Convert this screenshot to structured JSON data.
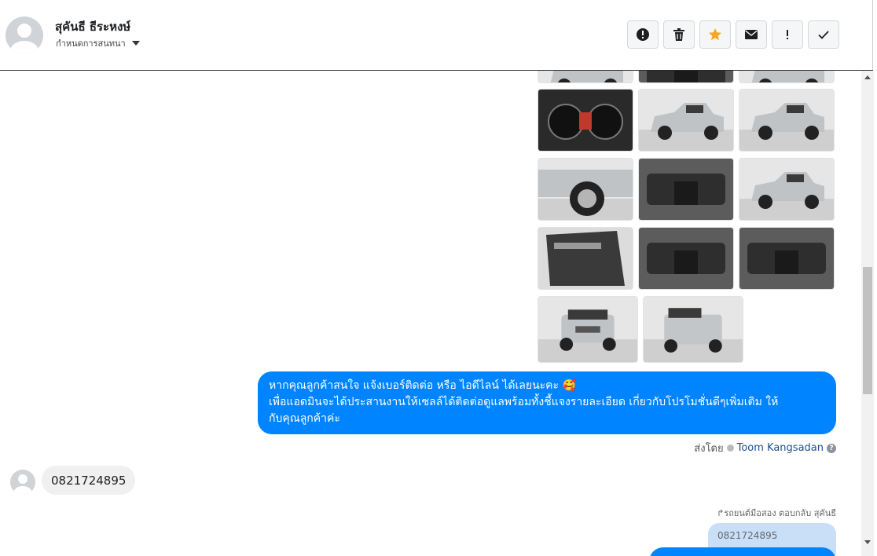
{
  "header": {
    "contact_name": "สุคันธี ธีระหงษ์",
    "assign_label": "กำหนดการสนทนา",
    "actions": [
      {
        "name": "spam-button",
        "icon": "alert-circle-icon"
      },
      {
        "name": "delete-button",
        "icon": "trash-icon"
      },
      {
        "name": "star-button",
        "icon": "star-icon",
        "color": "#f5a623"
      },
      {
        "name": "mark-unread-button",
        "icon": "envelope-icon"
      },
      {
        "name": "important-button",
        "icon": "exclamation-icon"
      },
      {
        "name": "done-button",
        "icon": "check-icon"
      }
    ]
  },
  "photos": {
    "count": 14,
    "subject": "gray pickup truck photos"
  },
  "messages": {
    "outgoing_lines": [
      "หากคุณลูกค้าสนใจ แจ้งเบอร์ติดต่อ หรือ ไอดีไลน์ ได้เลยนะคะ 🥰",
      "เพื่อแอดมินจะได้ประสานงานให้เซลล์ได้ติดต่อดูแลพร้อมทั้งชี้แจงรายละเอียด เกี่ยวกับโปรโมชั่นดีๆเพิ่มเติม ให้",
      "กับคุณลูกค้าค่ะ"
    ],
    "sent_by_label": "ส่งโดย",
    "sent_by_name": "Toom Kangsadan",
    "help_glyph": "?",
    "incoming_phone": "0821724895",
    "reply_note": "รถยนต์มือสอง ตอบกลับ สุคันธี",
    "quoted_text": "0821724895"
  },
  "colors": {
    "accent": "#0084ff",
    "quoted_bg": "#c9dff8",
    "incoming_bg": "#f0f0f0"
  }
}
